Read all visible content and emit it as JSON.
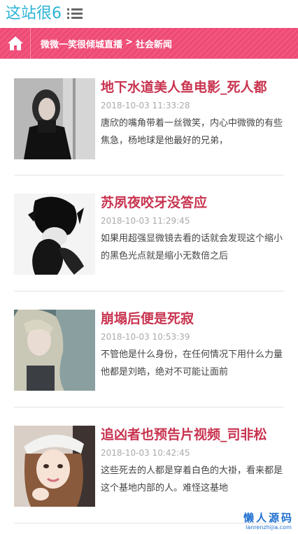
{
  "header": {
    "logo": "这站很6",
    "menu_icon": "menu-list-icon"
  },
  "breadcrumb": {
    "home_icon": "home-icon",
    "site": "微微一笑很倾城直播",
    "separator": ">",
    "category": "社会新闻"
  },
  "articles": [
    {
      "title": "地下水道美人鱼电影_死人都",
      "date": "2018-10-03 11:33:28",
      "excerpt": "唐欣的嘴角带着一丝微笑，内心中微微的有些焦急，杨地球是他最好的兄弟，"
    },
    {
      "title": "苏夙夜咬牙没答应",
      "date": "2018-10-03 11:29:45",
      "excerpt": "如果用超强显微镜去看的话就会发现这个缩小的黑色光点就是缩小无数倍之后"
    },
    {
      "title": "崩塌后便是死寂",
      "date": "2018-10-03 10:53:39",
      "excerpt": "不管他是什么身份，在任何情况下用什么力量他都是刘皓，绝对不可能让面前"
    },
    {
      "title": "追凶者也预告片视频_司非松",
      "date": "2018-10-03 10:42:45",
      "excerpt": "这些死去的人都是穿着白色的大褂，看来都是这个基地内部的人。难怪这基地"
    }
  ],
  "watermark": {
    "main": "懒人源码",
    "sub": "lanrenzhijia.com"
  }
}
